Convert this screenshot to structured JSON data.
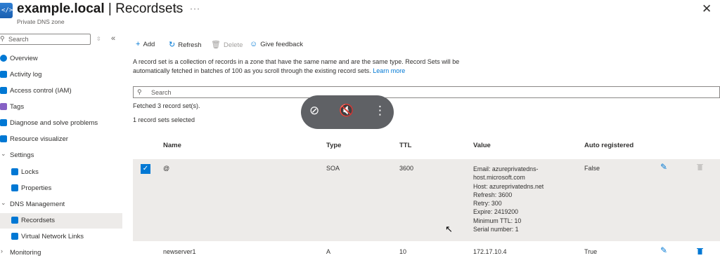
{
  "header": {
    "title": "example.local",
    "separator": "|",
    "section": "Recordsets",
    "subtitle": "Private DNS zone",
    "favorite_icon": "star-icon",
    "more_icon": "ellipsis-icon",
    "close_icon": "close-icon"
  },
  "sidebar": {
    "search_placeholder": "Search",
    "items": [
      {
        "label": "Overview",
        "icon": "overview-icon",
        "color": "#0078d4"
      },
      {
        "label": "Activity log",
        "icon": "activity-log-icon",
        "color": "#0078d4"
      },
      {
        "label": "Access control (IAM)",
        "icon": "iam-icon",
        "color": "#0078d4"
      },
      {
        "label": "Tags",
        "icon": "tag-icon",
        "color": "#8661c5"
      },
      {
        "label": "Diagnose and solve problems",
        "icon": "wrench-icon",
        "color": "#0078d4"
      },
      {
        "label": "Resource visualizer",
        "icon": "visualizer-icon",
        "color": "#0078d4"
      },
      {
        "label": "Settings",
        "icon": "chevron-down-icon"
      },
      {
        "label": "Locks",
        "icon": "lock-icon",
        "color": "#0078d4"
      },
      {
        "label": "Properties",
        "icon": "properties-icon",
        "color": "#0078d4"
      },
      {
        "label": "DNS Management",
        "icon": "chevron-down-icon"
      },
      {
        "label": "Recordsets",
        "icon": "recordsets-icon",
        "color": "#0078d4"
      },
      {
        "label": "Virtual Network Links",
        "icon": "network-links-icon",
        "color": "#0078d4"
      },
      {
        "label": "Monitoring",
        "icon": "chevron-right-icon"
      }
    ]
  },
  "toolbar": {
    "add": "Add",
    "refresh": "Refresh",
    "delete": "Delete",
    "feedback": "Give feedback"
  },
  "description": {
    "text": "A record set is a collection of records in a zone that have the same name and are the same type. Record Sets will be automatically fetched in batches of 100 as you scroll through the existing record sets.",
    "link": "Learn more"
  },
  "search": {
    "placeholder": "Search"
  },
  "status": {
    "fetched": "Fetched 3 record set(s).",
    "selected": "1 record sets selected"
  },
  "table": {
    "columns": [
      "Name",
      "Type",
      "TTL",
      "Value",
      "Auto registered"
    ],
    "rows": [
      {
        "name": "@",
        "type": "SOA",
        "ttl": "3600",
        "value_lines": [
          "Email: azureprivatedns-",
          "host.microsoft.com",
          "Host: azureprivatedns.net",
          "Refresh: 3600",
          "Retry: 300",
          "Expire: 2419200",
          "Minimum TTL: 10",
          "Serial number: 1"
        ],
        "auto_registered": "False",
        "selected": true
      },
      {
        "name": "newserver1",
        "type": "A",
        "ttl": "10",
        "value_lines": [
          "172.17.10.4"
        ],
        "auto_registered": "True",
        "selected": false
      }
    ]
  },
  "overlay": {
    "icons": [
      "unpin-icon",
      "mute-icon",
      "more-vertical-icon"
    ]
  }
}
